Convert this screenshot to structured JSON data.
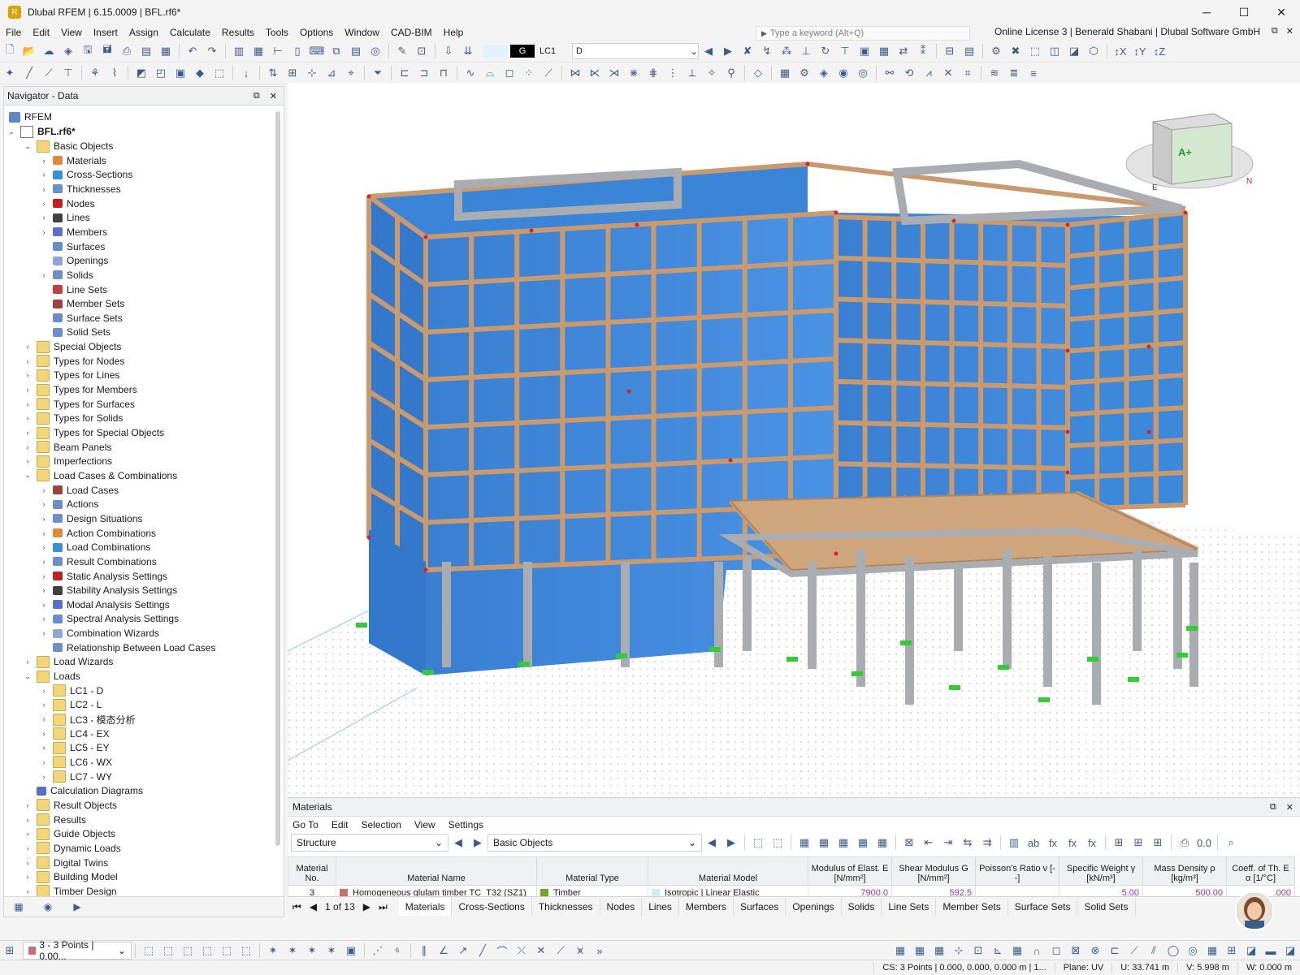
{
  "window": {
    "title": "Dlubal RFEM | 6.15.0009 | BFL.rf6*"
  },
  "menu": {
    "items": [
      "File",
      "Edit",
      "View",
      "Insert",
      "Assign",
      "Calculate",
      "Results",
      "Tools",
      "Options",
      "Window",
      "CAD-BIM",
      "Help"
    ],
    "search_placeholder": "Type a keyword (Alt+Q)",
    "license": "Online License 3 | Benerald Shabani | Dlubal Software GmbH"
  },
  "loadcase": {
    "badge": "G",
    "code": "LC1",
    "name": "D"
  },
  "navigator": {
    "title": "Navigator - Data",
    "root": "RFEM",
    "file": "BFL.rf6*",
    "items": [
      "Basic Objects",
      "Materials",
      "Cross-Sections",
      "Thicknesses",
      "Nodes",
      "Lines",
      "Members",
      "Surfaces",
      "Openings",
      "Solids",
      "Line Sets",
      "Member Sets",
      "Surface Sets",
      "Solid Sets",
      "Special Objects",
      "Types for Nodes",
      "Types for Lines",
      "Types for Members",
      "Types for Surfaces",
      "Types for Solids",
      "Types for Special Objects",
      "Beam Panels",
      "Imperfections",
      "Load Cases & Combinations",
      "Load Cases",
      "Actions",
      "Design Situations",
      "Action Combinations",
      "Load Combinations",
      "Result Combinations",
      "Static Analysis Settings",
      "Stability Analysis Settings",
      "Modal Analysis Settings",
      "Spectral Analysis Settings",
      "Combination Wizards",
      "Relationship Between Load Cases",
      "Load Wizards",
      "Loads",
      "LC1 - D",
      "LC2 - L",
      "LC3 - 模态分析",
      "LC4 - EX",
      "LC5 - EY",
      "LC6 - WX",
      "LC7 - WY",
      "Calculation Diagrams",
      "Result Objects",
      "Results",
      "Guide Objects",
      "Dynamic Loads",
      "Digital Twins",
      "Building Model",
      "Timber Design"
    ]
  },
  "viewcube": {
    "label_a": "A+",
    "label_e": "E",
    "label_n": "N"
  },
  "materials": {
    "title": "Materials",
    "menu": [
      "Go To",
      "Edit",
      "Selection",
      "View",
      "Settings"
    ],
    "combo_structure": "Structure",
    "combo_basic": "Basic Objects",
    "columns": [
      "Material No.",
      "Material Name",
      "Material Type",
      "Material Model",
      "Modulus of Elast. E [N/mm²]",
      "Shear Modulus G [N/mm²]",
      "Poisson's Ratio ν [--]",
      "Specific Weight γ [kN/m³]",
      "Mass Density ρ [kg/m³]",
      "Coeff. of Th. E α [1/°C]"
    ],
    "row": {
      "no": "3",
      "name": "Homogeneous glulam timber TC_T32 (SZ1)",
      "type": "Timber",
      "model": "Isotropic | Linear Elastic",
      "e": "7900.0",
      "g": "592.5",
      "nu": "",
      "gamma": "5.00",
      "rho": "500.00",
      "alpha": ".000"
    },
    "pager": "1 of 13",
    "tabs": [
      "Materials",
      "Cross-Sections",
      "Thicknesses",
      "Nodes",
      "Lines",
      "Members",
      "Surfaces",
      "Openings",
      "Solids",
      "Line Sets",
      "Member Sets",
      "Surface Sets",
      "Solid Sets"
    ]
  },
  "bottom": {
    "selection": "3 - 3 Points | 0.00..."
  },
  "status": {
    "cs": "CS: 3 Points | 0.000, 0.000, 0.000 m | 1...",
    "plane": "Plane: UV",
    "u": "U: 33.741 m",
    "v": "V: 5.998 m",
    "w": "W: 0.000 m"
  },
  "colors": {
    "accent": "#3a5e8c",
    "wall": "#3a85d8",
    "timber": "#c99a6e",
    "concrete": "#a9acb0",
    "support": "#33cc33",
    "node": "#e02020"
  }
}
